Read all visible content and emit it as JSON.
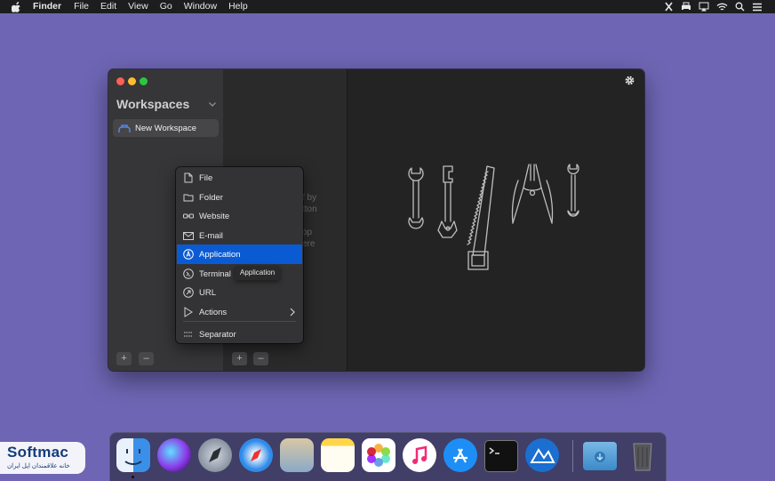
{
  "menubar": {
    "apple_icon": "apple-icon",
    "app_name": "Finder",
    "items": [
      "File",
      "Edit",
      "View",
      "Go",
      "Window",
      "Help"
    ],
    "status_icons": [
      "tools-icon",
      "printer-icon",
      "airplay-icon",
      "wifi-icon",
      "search-icon",
      "list-icon"
    ]
  },
  "window": {
    "sidebar": {
      "title": "Workspaces",
      "workspaces": [
        "New Workspace"
      ],
      "add_label": "+",
      "remove_label": "–"
    },
    "middle": {
      "hint_lines": [
        "f by",
        "tton",
        "op",
        "ere"
      ],
      "add_label": "+",
      "remove_label": "–"
    },
    "main": {
      "settings_icon": "gear-icon",
      "illustration": "tools-illustration"
    }
  },
  "popup_menu": {
    "items": [
      {
        "label": "File",
        "icon": "file-icon"
      },
      {
        "label": "Folder",
        "icon": "folder-icon"
      },
      {
        "label": "Website",
        "icon": "link-icon"
      },
      {
        "label": "E-mail",
        "icon": "mail-icon"
      },
      {
        "label": "Application",
        "icon": "app-store-icon",
        "active": true
      },
      {
        "label": "Terminal",
        "icon": "terminal-icon"
      },
      {
        "label": "URL",
        "icon": "url-icon"
      },
      {
        "label": "Actions",
        "icon": "play-icon",
        "has_submenu": true
      },
      {
        "label": "Separator",
        "icon": "separator-icon"
      }
    ],
    "tooltip": "Application"
  },
  "dock": {
    "apps": [
      "Finder",
      "Siri",
      "Launchpad",
      "Safari",
      "Preview",
      "Notes",
      "Photos",
      "iTunes",
      "App Store",
      "Terminal",
      "Workspaces"
    ],
    "others": [
      "Downloads",
      "Trash"
    ]
  },
  "watermark": {
    "brand": "Softmac",
    "tagline": "خانه علاقمندان اپل ایران"
  },
  "colors": {
    "desktop": "#6e66b4",
    "accent": "#0a5bd3"
  }
}
